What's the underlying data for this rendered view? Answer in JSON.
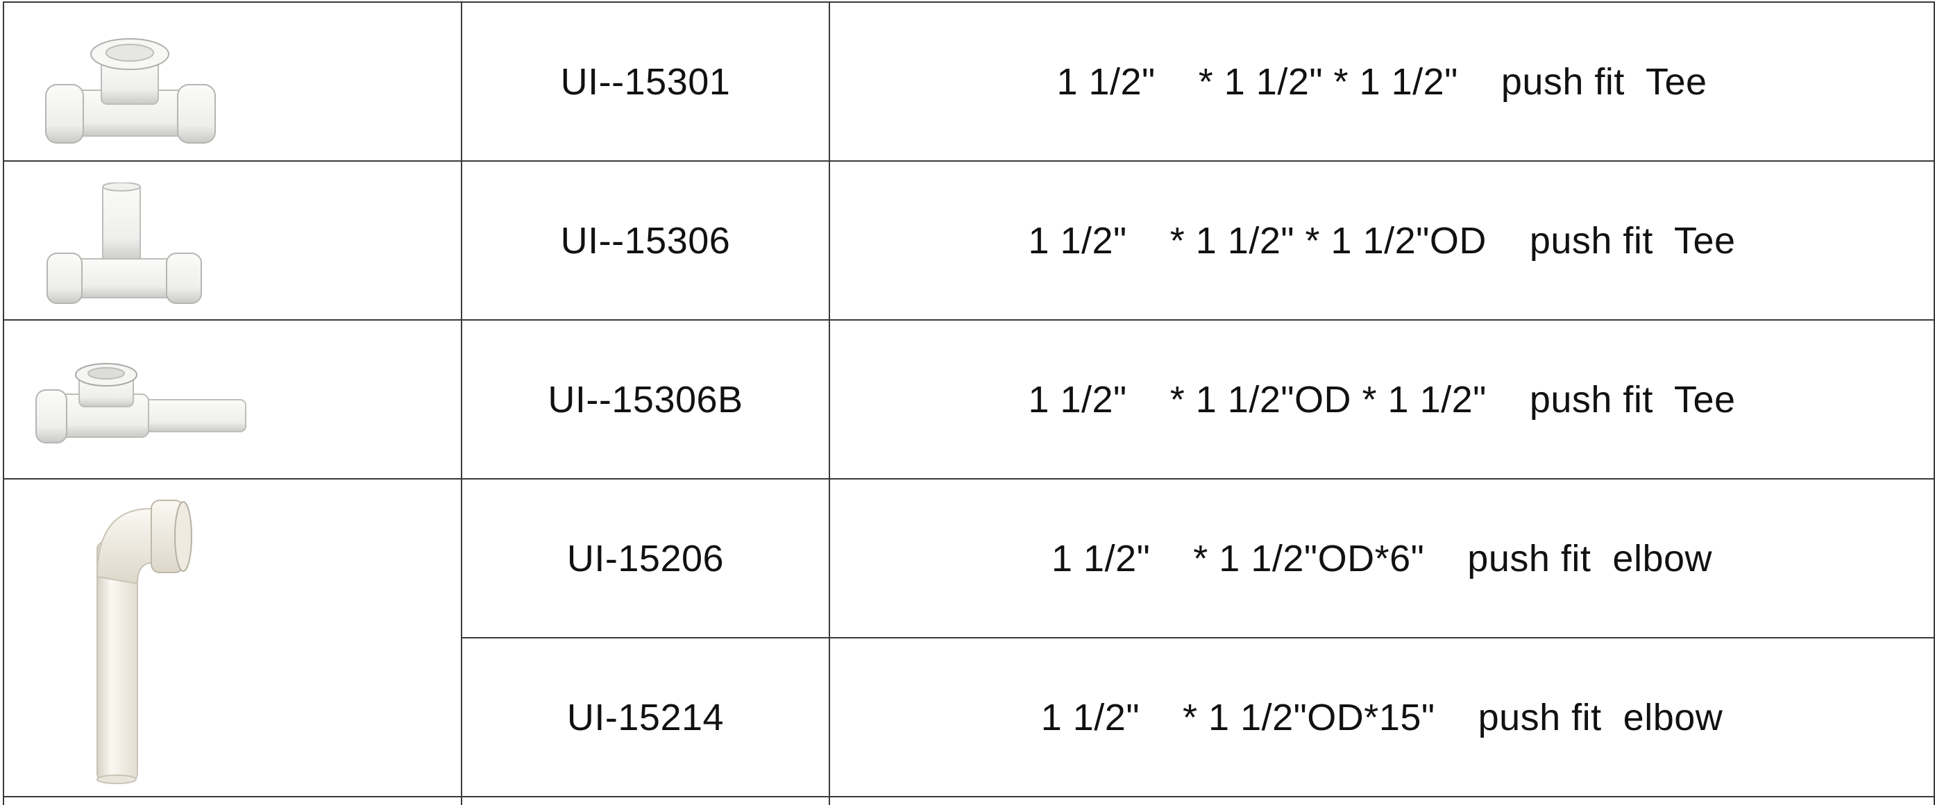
{
  "table": {
    "rows": [
      {
        "code": "UI--15301",
        "description": "1 1/2\"    * 1 1/2\" * 1 1/2\"    push fit  Tee",
        "image": "tee-fitting-icon"
      },
      {
        "code": "UI--15306",
        "description": "1 1/2\"    * 1 1/2\" * 1 1/2\"OD    push fit  Tee",
        "image": "tee-fitting-with-spigot-icon"
      },
      {
        "code": "UI--15306B",
        "description": "1 1/2\"    * 1 1/2\"OD * 1 1/2\"    push fit  Tee",
        "image": "tee-fitting-long-branch-icon"
      },
      {
        "code": "UI-15206",
        "description": "1 1/2\"    * 1 1/2\"OD*6\"    push fit  elbow",
        "image": "elbow-fitting-icon"
      },
      {
        "code": "UI-15214",
        "description": "1 1/2\"    * 1 1/2\"OD*15\"    push fit  elbow",
        "image": ""
      }
    ]
  },
  "colors": {
    "border": "#3a3a3a",
    "fitting_body": "#f4f4f2",
    "fitting_shadow": "#c9c9c6",
    "elbow_body": "#f3f0e6"
  }
}
